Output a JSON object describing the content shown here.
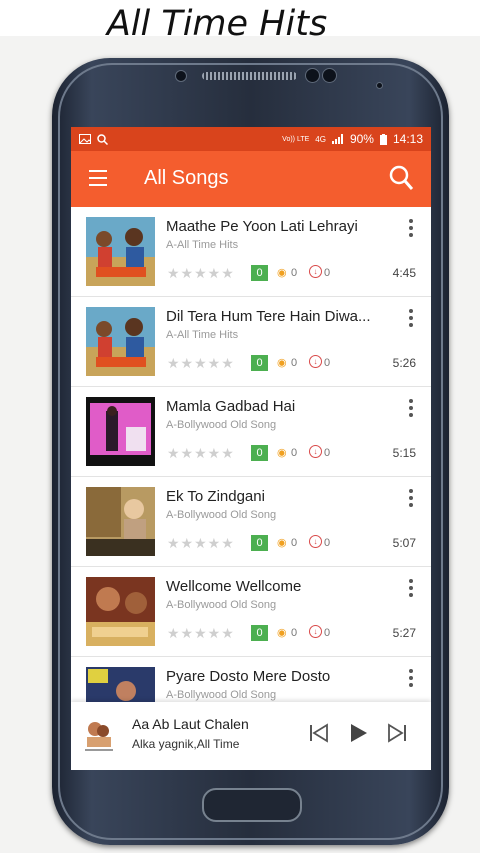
{
  "banner": {
    "title": "All Time Hits"
  },
  "status_bar": {
    "network": "Vo)) LTE",
    "signal": "4G",
    "battery": "90%",
    "time": "14:13"
  },
  "app_bar": {
    "title": "All Songs",
    "menu_icon": "hamburger-menu-icon",
    "search_icon": "search-icon"
  },
  "songs": [
    {
      "title": "Maathe Pe Yoon Lati Lehrayi",
      "album": "A-All Time Hits",
      "count": "0",
      "views": "0",
      "downloads": "0",
      "duration": "4:45"
    },
    {
      "title": "Dil Tera Hum Tere Hain Diwa...",
      "album": "A-All Time Hits",
      "count": "0",
      "views": "0",
      "downloads": "0",
      "duration": "5:26"
    },
    {
      "title": "Mamla Gadbad Hai",
      "album": "A-Bollywood Old Song",
      "count": "0",
      "views": "0",
      "downloads": "0",
      "duration": "5:15"
    },
    {
      "title": "Ek To Zindgani",
      "album": "A-Bollywood Old Song",
      "count": "0",
      "views": "0",
      "downloads": "0",
      "duration": "5:07"
    },
    {
      "title": "Wellcome Wellcome",
      "album": "A-Bollywood Old Song",
      "count": "0",
      "views": "0",
      "downloads": "0",
      "duration": "5:27"
    },
    {
      "title": "Pyare  Dosto Mere Dosto",
      "album": "A-Bollywood Old Song",
      "count": "",
      "views": "",
      "downloads": "",
      "duration": ""
    }
  ],
  "player": {
    "title": "Aa Ab Laut Chalen",
    "artist": "Alka yagnik,All Time"
  },
  "colors": {
    "accent": "#f45d2e",
    "status_bar": "#d9441c",
    "badge": "#4caf50"
  }
}
